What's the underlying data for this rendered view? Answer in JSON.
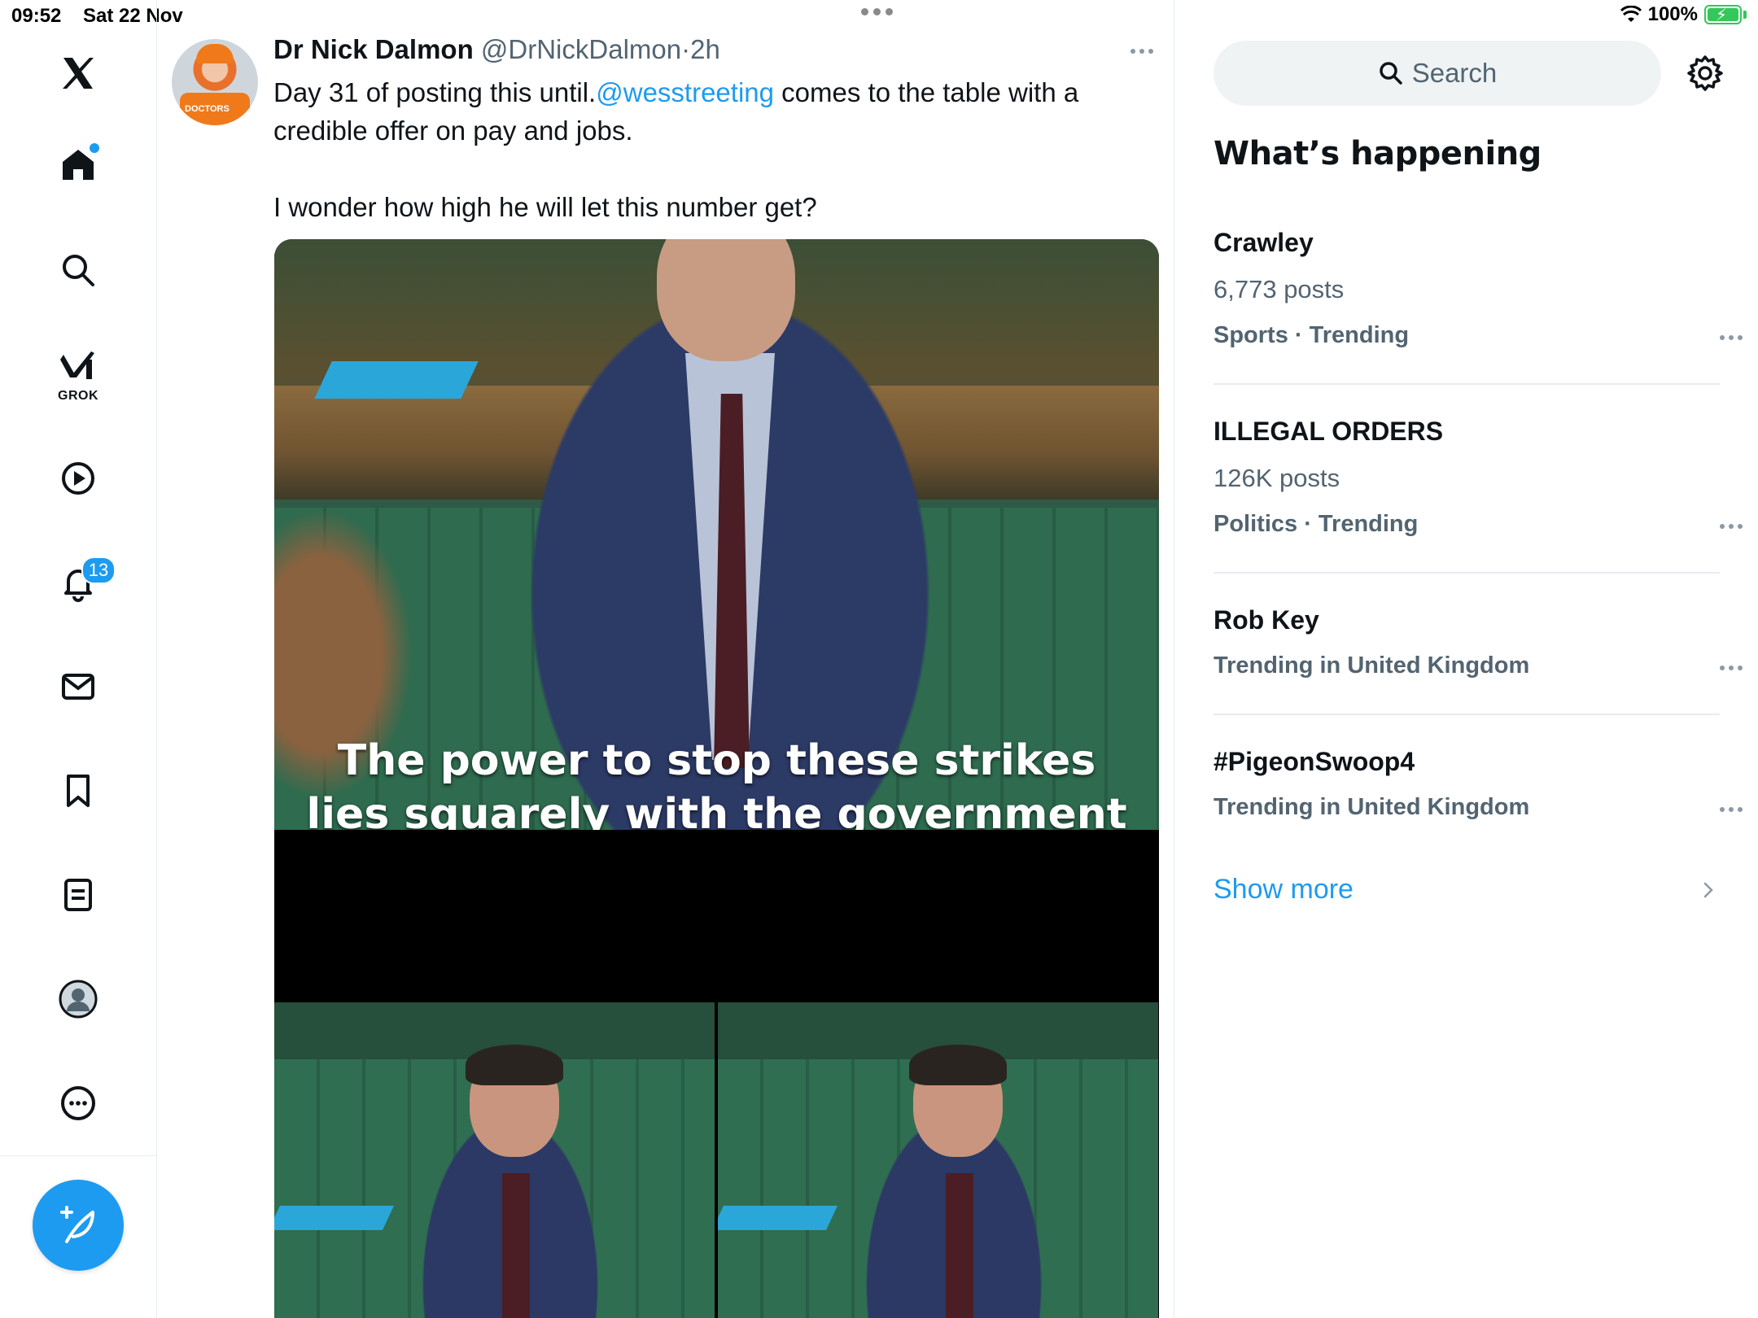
{
  "status_bar": {
    "time": "09:52",
    "date": "Sat 22 Nov",
    "battery": "100%"
  },
  "nav": {
    "grok_label": "GROK",
    "notifications_count": "13"
  },
  "tweet": {
    "name": "Dr Nick Dalmon",
    "handle": "@DrNickDalmon",
    "sep": "·",
    "time": "2h",
    "text_before": "Day 31 of posting this until.",
    "mention": "@wesstreeting",
    "text_after": " comes to the table with a credible offer on pay and jobs.",
    "text_line2": "I wonder how high he will let this number get?",
    "media_caption_line1": "The power to stop these strikes",
    "media_caption_line2": "lies squarely with the government",
    "avatar_tag": "DOCTORS"
  },
  "sidebar": {
    "search_placeholder": "Search",
    "title": "What’s happening",
    "trends": [
      {
        "name": "Crawley",
        "posts": "6,773 posts",
        "category": "Sports · Trending"
      },
      {
        "name": "ILLEGAL ORDERS",
        "posts": "126K posts",
        "category": "Politics · Trending"
      },
      {
        "name": "Rob Key",
        "posts": "",
        "category": "Trending in United Kingdom"
      },
      {
        "name": "#PigeonSwoop4",
        "posts": "",
        "category": "Trending in United Kingdom"
      }
    ],
    "show_more": "Show more"
  },
  "colors": {
    "accent": "#1d9bf0",
    "muted": "#536471",
    "text": "#0f1419"
  }
}
